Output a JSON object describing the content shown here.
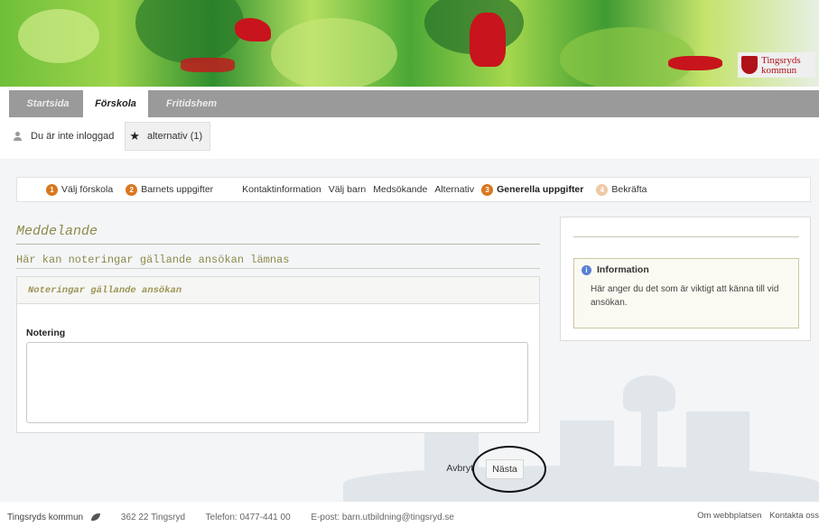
{
  "banner": {
    "logo_text": "Tingsryds kommun"
  },
  "tabs": [
    {
      "label": "Startsida"
    },
    {
      "label": "Förskola"
    },
    {
      "label": "Fritidshem"
    }
  ],
  "loginbar": {
    "status": "Du är inte inloggad",
    "alternatives": "alternativ (1)"
  },
  "steps": [
    {
      "number": "1",
      "label": "Välj förskola"
    },
    {
      "number": "2",
      "label": "Barnets uppgifter"
    },
    {
      "label": "Kontaktinformation"
    },
    {
      "label": "Välj barn"
    },
    {
      "label": "Medsökande"
    },
    {
      "label": "Alternativ"
    },
    {
      "number": "3",
      "label": "Generella uppgifter"
    },
    {
      "number": "4",
      "label": "Bekräfta"
    }
  ],
  "main": {
    "title": "Meddelande",
    "subtitle": "Här kan noteringar gällande ansökan lämnas",
    "panel_title": "Noteringar gällande ansökan",
    "field_label": "Notering",
    "field_value": ""
  },
  "info": {
    "title": "Information",
    "text": "Här anger du det som är viktigt att känna till vid ansökan."
  },
  "buttons": {
    "cancel": "Avbryt",
    "next": "Nästa"
  },
  "footer": {
    "org": "Tingsryds kommun",
    "address": "362 22 Tingsryd",
    "phone": "Telefon: 0477-441 00",
    "email": "E-post: barn.utbildning@tingsryd.se",
    "link_about": "Om webbplatsen",
    "link_contact": "Kontakta oss"
  }
}
